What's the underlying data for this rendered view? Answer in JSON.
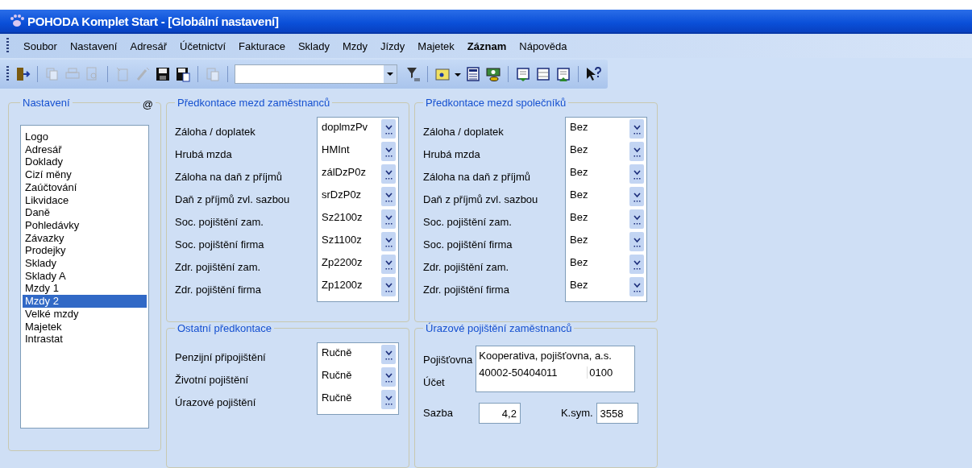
{
  "window": {
    "title": "POHODA Komplet Start - [Globální nastavení]"
  },
  "menu": [
    {
      "label": "Soubor",
      "bold": false
    },
    {
      "label": "Nastavení",
      "bold": false
    },
    {
      "label": "Adresář",
      "bold": false
    },
    {
      "label": "Účetnictví",
      "bold": false
    },
    {
      "label": "Fakturace",
      "bold": false
    },
    {
      "label": "Sklady",
      "bold": false
    },
    {
      "label": "Mzdy",
      "bold": false
    },
    {
      "label": "Jízdy",
      "bold": false
    },
    {
      "label": "Majetek",
      "bold": false
    },
    {
      "label": "Záznam",
      "bold": true
    },
    {
      "label": "Nápověda",
      "bold": false
    }
  ],
  "toolbar": [
    {
      "kind": "exit",
      "disabled": false
    },
    {
      "kind": "separator"
    },
    {
      "kind": "copy",
      "disabled": true
    },
    {
      "kind": "print",
      "disabled": true
    },
    {
      "kind": "preview",
      "disabled": true
    },
    {
      "kind": "separator"
    },
    {
      "kind": "new",
      "disabled": true
    },
    {
      "kind": "wand",
      "disabled": true
    },
    {
      "kind": "save",
      "disabled": false
    },
    {
      "kind": "saveas",
      "disabled": false
    },
    {
      "kind": "separator"
    },
    {
      "kind": "paste",
      "disabled": true
    },
    {
      "kind": "separator"
    },
    {
      "kind": "combo"
    },
    {
      "kind": "filter",
      "disabled": false
    },
    {
      "kind": "separator"
    },
    {
      "kind": "folder",
      "disabled": false
    },
    {
      "kind": "calc",
      "disabled": false
    },
    {
      "kind": "money",
      "disabled": false
    },
    {
      "kind": "separator"
    },
    {
      "kind": "rowdown",
      "disabled": false
    },
    {
      "kind": "form",
      "disabled": false
    },
    {
      "kind": "rowup",
      "disabled": false
    },
    {
      "kind": "separator"
    },
    {
      "kind": "help",
      "disabled": false
    }
  ],
  "settings": {
    "legend": "Nastavení",
    "marker": "@",
    "items": [
      {
        "label": "Logo",
        "selected": false
      },
      {
        "label": "Adresář",
        "selected": false
      },
      {
        "label": "Doklady",
        "selected": false
      },
      {
        "label": "Cizí měny",
        "selected": false
      },
      {
        "label": "Zaúčtování",
        "selected": false
      },
      {
        "label": "Likvidace",
        "selected": false
      },
      {
        "label": "Daně",
        "selected": false
      },
      {
        "label": "Pohledávky",
        "selected": false
      },
      {
        "label": "Závazky",
        "selected": false
      },
      {
        "label": "Prodejky",
        "selected": false
      },
      {
        "label": "Sklady",
        "selected": false
      },
      {
        "label": "Sklady A",
        "selected": false
      },
      {
        "label": "Mzdy 1",
        "selected": false
      },
      {
        "label": "Mzdy 2",
        "selected": true
      },
      {
        "label": "Velké mzdy",
        "selected": false
      },
      {
        "label": "Majetek",
        "selected": false
      },
      {
        "label": "Intrastat",
        "selected": false
      }
    ]
  },
  "employees": {
    "legend": "Předkontace mezd zaměstnanců",
    "rows": [
      {
        "label": "Záloha / doplatek",
        "value": "doplmzPv"
      },
      {
        "label": "Hrubá mzda",
        "value": "HMInt"
      },
      {
        "label": "Záloha na daň z příjmů",
        "value": "zálDzP0z"
      },
      {
        "label": "Daň z příjmů zvl. sazbou",
        "value": "srDzP0z"
      },
      {
        "label": "Soc. pojištění zam.",
        "value": "Sz2100z"
      },
      {
        "label": "Soc. pojištění firma",
        "value": "Sz1100z"
      },
      {
        "label": "Zdr. pojištění zam.",
        "value": "Zp2200z"
      },
      {
        "label": "Zdr. pojištění firma",
        "value": "Zp1200z"
      }
    ]
  },
  "other": {
    "legend": "Ostatní předkontace",
    "rows": [
      {
        "label": "Penzijní připojištění",
        "value": "Ručně"
      },
      {
        "label": "Životní pojištění",
        "value": "Ručně"
      },
      {
        "label": "Úrazové pojištění",
        "value": "Ručně"
      }
    ]
  },
  "partners": {
    "legend": "Předkontace mezd společníků",
    "rows": [
      {
        "label": "Záloha / doplatek",
        "value": "Bez"
      },
      {
        "label": "Hrubá mzda",
        "value": "Bez"
      },
      {
        "label": "Záloha na daň z příjmů",
        "value": "Bez"
      },
      {
        "label": "Daň z příjmů zvl. sazbou",
        "value": "Bez"
      },
      {
        "label": "Soc. pojištění zam.",
        "value": "Bez"
      },
      {
        "label": "Soc. pojištění firma",
        "value": "Bez"
      },
      {
        "label": "Zdr. pojištění zam.",
        "value": "Bez"
      },
      {
        "label": "Zdr. pojištění firma",
        "value": "Bez"
      }
    ]
  },
  "accident": {
    "legend": "Úrazové pojištění zaměstnanců",
    "insurer_label": "Pojišťovna",
    "insurer": "Kooperativa, pojišťovna, a.s.",
    "account_label": "Účet",
    "account": "40002-50404011",
    "bank_code": "0100",
    "rate_label": "Sazba",
    "rate": "4,2",
    "ksym_label": "K.sym.",
    "ksym": "3558"
  }
}
